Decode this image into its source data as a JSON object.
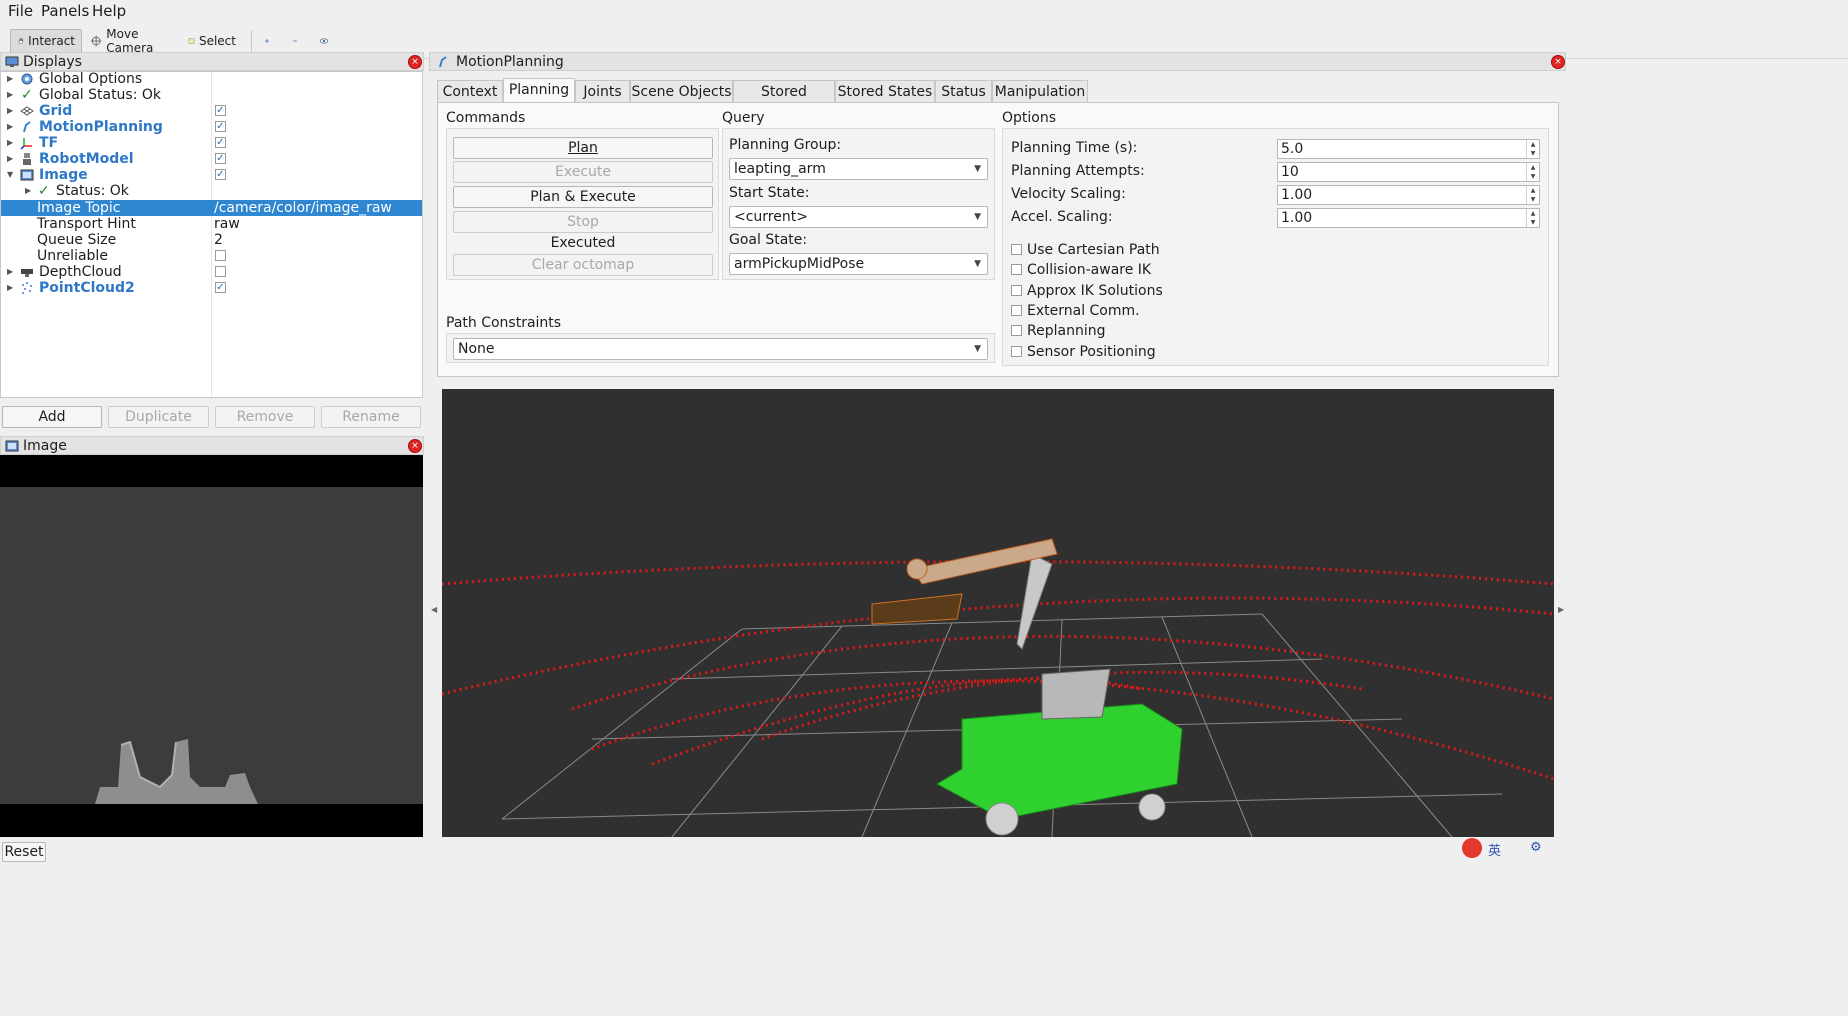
{
  "menu": {
    "file": "File",
    "panels": "Panels",
    "help": "Help"
  },
  "toolbar": {
    "interact": "Interact",
    "move_camera": "Move Camera",
    "select": "Select"
  },
  "displays": {
    "title": "Displays",
    "rows": [
      {
        "label": "Global Options"
      },
      {
        "label": "Global Status: Ok"
      },
      {
        "label": "Grid"
      },
      {
        "label": "MotionPlanning"
      },
      {
        "label": "TF"
      },
      {
        "label": "RobotModel"
      },
      {
        "label": "Image"
      },
      {
        "label": "Status: Ok"
      },
      {
        "label": "Image Topic",
        "value": "/camera/color/image_raw"
      },
      {
        "label": "Transport Hint",
        "value": "raw"
      },
      {
        "label": "Queue Size",
        "value": "2"
      },
      {
        "label": "Unreliable"
      },
      {
        "label": "DepthCloud"
      },
      {
        "label": "PointCloud2"
      }
    ],
    "buttons": {
      "add": "Add",
      "duplicate": "Duplicate",
      "remove": "Remove",
      "rename": "Rename"
    }
  },
  "image_panel": {
    "title": "Image"
  },
  "motion_planning": {
    "title": "MotionPlanning",
    "tabs": [
      "Context",
      "Planning",
      "Joints",
      "Scene Objects",
      "Stored Scenes",
      "Stored States",
      "Status",
      "Manipulation"
    ],
    "commands": {
      "title": "Commands",
      "plan": "Plan",
      "execute": "Execute",
      "plan_execute": "Plan & Execute",
      "stop": "Stop",
      "status": "Executed",
      "clear_octomap": "Clear octomap"
    },
    "query": {
      "title": "Query",
      "planning_group_label": "Planning Group:",
      "planning_group": "leapting_arm",
      "start_state_label": "Start State:",
      "start_state": "<current>",
      "goal_state_label": "Goal State:",
      "goal_state": "armPickupMidPose"
    },
    "path_constraints": {
      "title": "Path Constraints",
      "value": "None"
    },
    "options": {
      "title": "Options",
      "planning_time_label": "Planning Time (s):",
      "planning_time": "5.0",
      "planning_attempts_label": "Planning Attempts:",
      "planning_attempts": "10",
      "velocity_scaling_label": "Velocity Scaling:",
      "velocity_scaling": "1.00",
      "accel_scaling_label": "Accel. Scaling:",
      "accel_scaling": "1.00",
      "checkboxes": [
        "Use Cartesian Path",
        "Collision-aware IK",
        "Approx IK Solutions",
        "External Comm.",
        "Replanning",
        "Sensor Positioning"
      ]
    }
  },
  "statusbar": {
    "reset": "Reset",
    "ime": "英"
  }
}
